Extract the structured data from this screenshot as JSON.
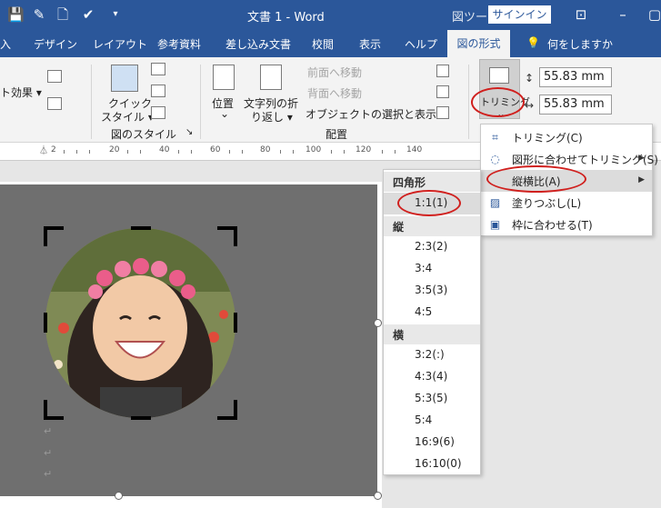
{
  "titlebar": {
    "title": "文書 1  -  Word",
    "context_tab": "図ツー",
    "signin_label": "サインイン",
    "qat_more": "▾"
  },
  "tabs": {
    "items": [
      "入",
      "デザイン",
      "レイアウト",
      "参考資料",
      "差し込み文書",
      "校閲",
      "表示",
      "ヘルプ"
    ],
    "active": "図の形式",
    "tellme": "何をしますか"
  },
  "ribbon": {
    "effects_label": "ト効果 ▾",
    "quick_style_line1": "クイック",
    "quick_style_line2": "スタイル ▾",
    "picture_styles_group": "図のスタイル",
    "position_label": "位置",
    "position_arrow": "⌄",
    "wrap_line1": "文字列の折",
    "wrap_line2": "り返し ▾",
    "bring_forward": "前面へ移動",
    "send_backward": "背面へ移動",
    "selection_pane": "オブジェクトの選択と表示",
    "arrange_group": "配置",
    "crop_label": "トリミング",
    "crop_arrow": "⌄",
    "height_value": "55.83 mm",
    "width_value": "55.83 mm"
  },
  "ruler": {
    "labels": [
      "2",
      "20",
      "40",
      "60",
      "80",
      "100",
      "120",
      "140"
    ]
  },
  "crop_menu": {
    "items": [
      {
        "label": "トリミング(C)",
        "icon": "crop-icon",
        "arrow": ""
      },
      {
        "label": "図形に合わせてトリミング(S)",
        "icon": "shape-crop-icon",
        "arrow": "▶"
      },
      {
        "label": "縦横比(A)",
        "icon": "",
        "arrow": "▶"
      },
      {
        "label": "塗りつぶし(L)",
        "icon": "fill-icon",
        "arrow": ""
      },
      {
        "label": "枠に合わせる(T)",
        "icon": "fit-icon",
        "arrow": ""
      }
    ]
  },
  "aspect_menu": {
    "square_header": "四角形",
    "square_items": [
      "1:1(1)"
    ],
    "portrait_header": "縦",
    "portrait_items": [
      "2:3(2)",
      "3:4",
      "3:5(3)",
      "4:5"
    ],
    "landscape_header": "横",
    "landscape_items": [
      "3:2(:)",
      "4:3(4)",
      "5:3(5)",
      "5:4",
      "16:9(6)",
      "16:10(0)"
    ]
  },
  "colors": {
    "word_blue": "#2b579a",
    "highlight": "#dcdcdc",
    "annotation_red": "#d0201e"
  }
}
